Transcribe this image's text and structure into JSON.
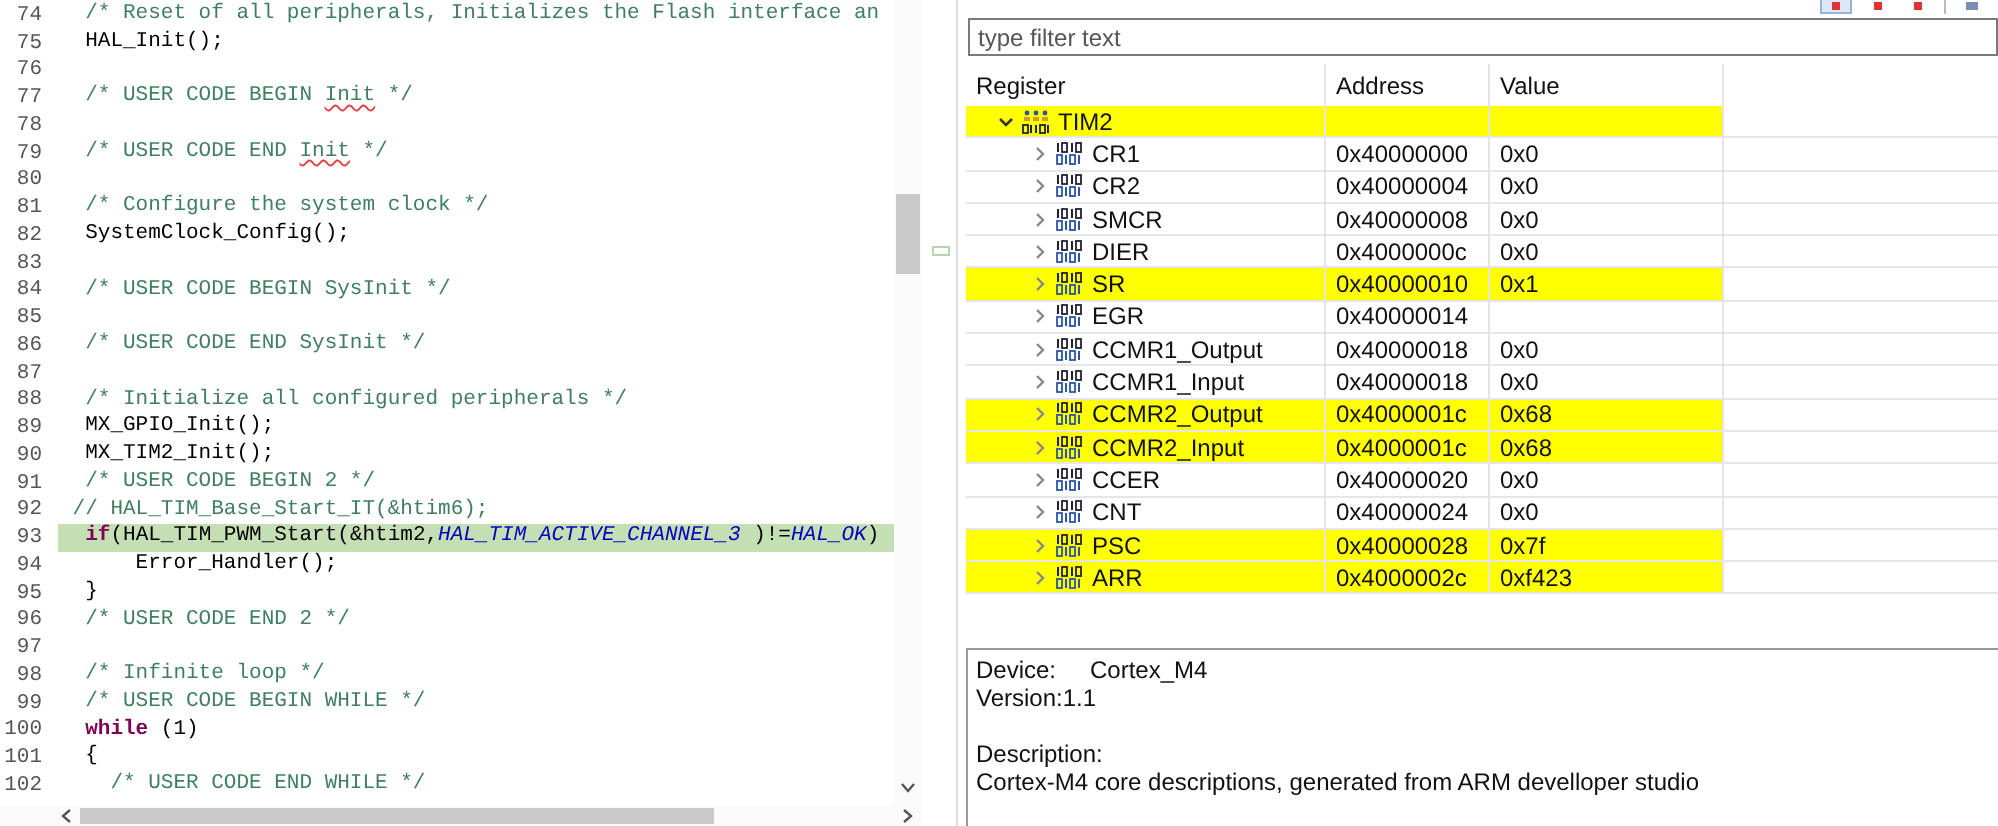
{
  "editor": {
    "lines": [
      {
        "number": "74",
        "current": false,
        "segments": [
          {
            "kind": "comment",
            "text": "  /* Reset of all peripherals, Initializes the Flash interface an"
          }
        ]
      },
      {
        "number": "75",
        "current": false,
        "segments": [
          {
            "kind": "code",
            "text": "  HAL_Init();"
          }
        ]
      },
      {
        "number": "76",
        "current": false
      },
      {
        "number": "77",
        "current": false,
        "segments": [
          {
            "kind": "comment",
            "text": "  /* USER CODE BEGIN "
          },
          {
            "kind": "misspelled",
            "text": "Init"
          },
          {
            "kind": "comment",
            "text": " */"
          }
        ]
      },
      {
        "number": "78",
        "current": false
      },
      {
        "number": "79",
        "current": false,
        "segments": [
          {
            "kind": "comment",
            "text": "  /* USER CODE END "
          },
          {
            "kind": "misspelled",
            "text": "Init"
          },
          {
            "kind": "comment",
            "text": " */"
          }
        ]
      },
      {
        "number": "80",
        "current": false
      },
      {
        "number": "81",
        "current": false,
        "segments": [
          {
            "kind": "comment",
            "text": "  /* Configure the system clock */"
          }
        ]
      },
      {
        "number": "82",
        "current": false,
        "segments": [
          {
            "kind": "code",
            "text": "  SystemClock_Config();"
          }
        ]
      },
      {
        "number": "83",
        "current": false
      },
      {
        "number": "84",
        "current": false,
        "segments": [
          {
            "kind": "comment",
            "text": "  /* USER CODE BEGIN SysInit */"
          }
        ]
      },
      {
        "number": "85",
        "current": false
      },
      {
        "number": "86",
        "current": false,
        "segments": [
          {
            "kind": "comment",
            "text": "  /* USER CODE END SysInit */"
          }
        ]
      },
      {
        "number": "87",
        "current": false
      },
      {
        "number": "88",
        "current": false,
        "segments": [
          {
            "kind": "comment",
            "text": "  /* Initialize all configured peripherals */"
          }
        ]
      },
      {
        "number": "89",
        "current": false,
        "segments": [
          {
            "kind": "code",
            "text": "  MX_GPIO_Init();"
          }
        ]
      },
      {
        "number": "90",
        "current": false,
        "segments": [
          {
            "kind": "code",
            "text": "  MX_TIM2_Init();"
          }
        ]
      },
      {
        "number": "91",
        "current": false,
        "segments": [
          {
            "kind": "comment",
            "text": "  /* USER CODE BEGIN 2 */"
          }
        ]
      },
      {
        "number": "92",
        "current": false,
        "segments": [
          {
            "kind": "comment",
            "text": " // HAL_TIM_Base_Start_IT(&htim6);"
          }
        ]
      },
      {
        "number": "93",
        "current": true,
        "segments": [
          {
            "kind": "keyword",
            "text": "  if"
          },
          {
            "kind": "code",
            "text": "(HAL_TIM_PWM_Start(&htim2,"
          },
          {
            "kind": "constant",
            "text": "HAL_TIM_ACTIVE_CHANNEL_3"
          },
          {
            "kind": "code",
            "text": " )!="
          },
          {
            "kind": "constant",
            "text": "HAL_OK"
          },
          {
            "kind": "code",
            "text": ")"
          }
        ]
      },
      {
        "number": "94",
        "current": false,
        "segments": [
          {
            "kind": "code",
            "text": "      Error_Handler();"
          }
        ]
      },
      {
        "number": "95",
        "current": false,
        "segments": [
          {
            "kind": "code",
            "text": "  }"
          }
        ]
      },
      {
        "number": "96",
        "current": false,
        "segments": [
          {
            "kind": "comment",
            "text": "  /* USER CODE END 2 */"
          }
        ]
      },
      {
        "number": "97",
        "current": false
      },
      {
        "number": "98",
        "current": false,
        "segments": [
          {
            "kind": "comment",
            "text": "  /* Infinite loop */"
          }
        ]
      },
      {
        "number": "99",
        "current": false,
        "segments": [
          {
            "kind": "comment",
            "text": "  /* USER CODE BEGIN WHILE */"
          }
        ]
      },
      {
        "number": "100",
        "current": false,
        "segments": [
          {
            "kind": "keyword",
            "text": "  while"
          },
          {
            "kind": "code",
            "text": " (1)"
          }
        ]
      },
      {
        "number": "101",
        "current": false,
        "segments": [
          {
            "kind": "code",
            "text": "  {"
          }
        ]
      },
      {
        "number": "102",
        "current": false,
        "segments": [
          {
            "kind": "comment",
            "text": "    /* USER CODE END WHILE */"
          }
        ]
      }
    ]
  },
  "registers": {
    "filter": {
      "placeholder": "type filter text"
    },
    "columns": [
      "Register",
      "Address",
      "Value"
    ],
    "rows": [
      {
        "kind": "peripheral",
        "name": "TIM2",
        "expanded": true,
        "changed": true,
        "children": [
          {
            "kind": "register",
            "name": "CR1",
            "address": "0x40000000",
            "value": "0x0",
            "expanded": false,
            "changed": false
          },
          {
            "kind": "register",
            "name": "CR2",
            "address": "0x40000004",
            "value": "0x0",
            "expanded": false,
            "changed": false
          },
          {
            "kind": "register",
            "name": "SMCR",
            "address": "0x40000008",
            "value": "0x0",
            "expanded": false,
            "changed": false
          },
          {
            "kind": "register",
            "name": "DIER",
            "address": "0x4000000c",
            "value": "0x0",
            "expanded": false,
            "changed": false
          },
          {
            "kind": "register",
            "name": "SR",
            "address": "0x40000010",
            "value": "0x1",
            "expanded": false,
            "changed": true
          },
          {
            "kind": "register",
            "name": "EGR",
            "address": "0x40000014",
            "expanded": false,
            "changed": false
          },
          {
            "kind": "register",
            "name": "CCMR1_Output",
            "address": "0x40000018",
            "value": "0x0",
            "expanded": false,
            "changed": false
          },
          {
            "kind": "register",
            "name": "CCMR1_Input",
            "address": "0x40000018",
            "value": "0x0",
            "expanded": false,
            "changed": false
          },
          {
            "kind": "register",
            "name": "CCMR2_Output",
            "address": "0x4000001c",
            "value": "0x68",
            "expanded": false,
            "changed": true
          },
          {
            "kind": "register",
            "name": "CCMR2_Input",
            "address": "0x4000001c",
            "value": "0x68",
            "expanded": false,
            "changed": true
          },
          {
            "kind": "register",
            "name": "CCER",
            "address": "0x40000020",
            "value": "0x0",
            "expanded": false,
            "changed": false
          },
          {
            "kind": "register",
            "name": "CNT",
            "address": "0x40000024",
            "value": "0x0",
            "expanded": false,
            "changed": false
          },
          {
            "kind": "register",
            "name": "PSC",
            "address": "0x40000028",
            "value": "0x7f",
            "expanded": false,
            "changed": true
          },
          {
            "kind": "register",
            "name": "ARR",
            "address": "0x4000002c",
            "value": "0xf423",
            "expanded": false,
            "changed": true
          }
        ]
      }
    ]
  },
  "details": {
    "device_label": "Device:",
    "device": "Cortex_M4",
    "version_label": "Version:",
    "version": "1.1",
    "description_label": "Description:",
    "description": "Cortex-M4 core descriptions, generated from ARM develloper studio"
  }
}
